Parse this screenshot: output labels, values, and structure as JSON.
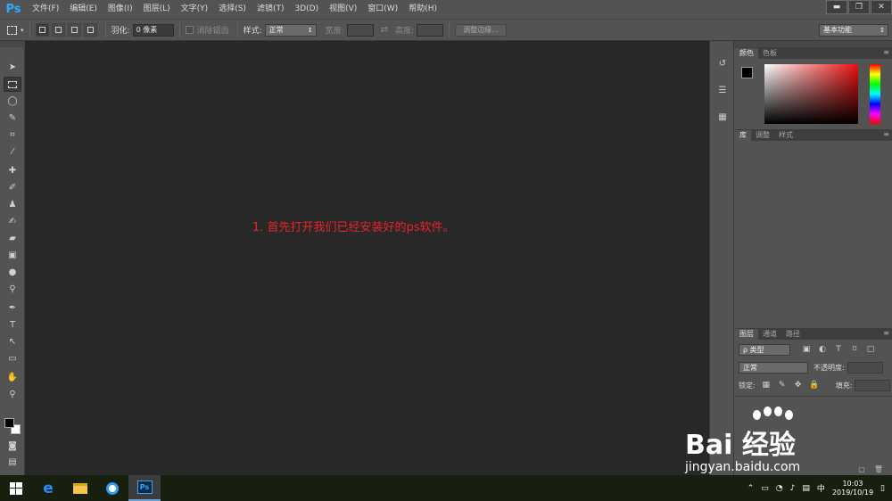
{
  "app": {
    "logo": "Ps"
  },
  "menu": [
    "文件(F)",
    "编辑(E)",
    "图像(I)",
    "图层(L)",
    "文字(Y)",
    "选择(S)",
    "滤镜(T)",
    "3D(D)",
    "视图(V)",
    "窗口(W)",
    "帮助(H)"
  ],
  "window_controls": {
    "minimize": "▬",
    "restore": "❐",
    "close": "✕"
  },
  "options": {
    "feather_label": "羽化:",
    "feather_value": "0 像素",
    "antialias_label": "消除锯齿",
    "style_label": "样式:",
    "style_value": "正常",
    "width_label": "宽度:",
    "height_label": "高度:",
    "refine_edge": "调整边缘...",
    "workspace": "基本功能"
  },
  "canvas": {
    "caption": "1. 首先打开我们已经安装好的ps软件。",
    "caption_color": "#e8242a"
  },
  "panels": {
    "color_tabs": [
      "颜色",
      "色板"
    ],
    "library_tabs": [
      "库",
      "调整",
      "样式"
    ],
    "layers_tabs": [
      "图层",
      "通道",
      "路径"
    ],
    "layers": {
      "filter_kind": "ρ 类型",
      "blend_mode": "正常",
      "opacity_label": "不透明度:",
      "lock_label": "锁定:",
      "fill_label": "填充:"
    }
  },
  "taskbar": {
    "time": "10:03",
    "date": "2019/10/19",
    "ime": "中",
    "ps_label": "Ps"
  },
  "watermark": {
    "brand": "Bai 经验",
    "url": "jingyan.baidu.com"
  }
}
